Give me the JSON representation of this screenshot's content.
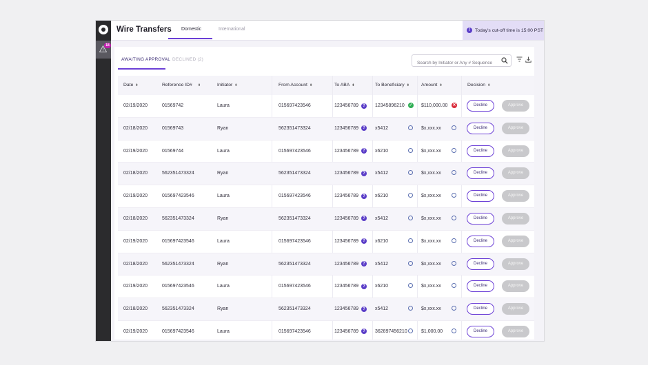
{
  "app": {
    "title": "Wire Transfers",
    "alert_badge": "18"
  },
  "top_tabs": [
    {
      "label": "Domestic",
      "active": true
    },
    {
      "label": "International",
      "active": false
    }
  ],
  "cutoff_notice": "Today's cut-off time is 15:00 PST",
  "sub_tabs": [
    {
      "label": "AWAITING APPROVAL",
      "active": true
    },
    {
      "label": "DECLINED (2)",
      "active": false
    }
  ],
  "search": {
    "placeholder": "Search by Initiator or Any # Sequence"
  },
  "columns": [
    "Date",
    "Reference ID#",
    "Initiator",
    "From Account",
    "To ABA",
    "To Beneficiary",
    "Amount",
    "Decision"
  ],
  "actions": {
    "decline": "Decline",
    "approve": "Approve"
  },
  "rows": [
    {
      "date": "02/19/2020",
      "ref": "01569742",
      "initiator": "Laura",
      "from": "015697423546",
      "aba": "123456789",
      "beneficiary": "12345896210",
      "ben_status": "verified",
      "amount": "$110,000.00",
      "amt_status": "error"
    },
    {
      "date": "02/18/2020",
      "ref": "01569743",
      "initiator": "Ryan",
      "from": "562351473324",
      "aba": "123456789",
      "beneficiary": "x5412",
      "ben_status": "pending",
      "amount": "$x,xxx.xx",
      "amt_status": "pending"
    },
    {
      "date": "02/19/2020",
      "ref": "01569744",
      "initiator": "Laura",
      "from": "015697423546",
      "aba": "123456789",
      "beneficiary": "x6210",
      "ben_status": "pending",
      "amount": "$x,xxx.xx",
      "amt_status": "pending"
    },
    {
      "date": "02/18/2020",
      "ref": "562351473324",
      "initiator": "Ryan",
      "from": "562351473324",
      "aba": "123456789",
      "beneficiary": "x5412",
      "ben_status": "pending",
      "amount": "$x,xxx.xx",
      "amt_status": "pending"
    },
    {
      "date": "02/19/2020",
      "ref": "015697423546",
      "initiator": "Laura",
      "from": "015697423546",
      "aba": "123456789",
      "beneficiary": "x6210",
      "ben_status": "pending",
      "amount": "$x,xxx.xx",
      "amt_status": "pending"
    },
    {
      "date": "02/18/2020",
      "ref": "562351473324",
      "initiator": "Ryan",
      "from": "562351473324",
      "aba": "123456789",
      "beneficiary": "x5412",
      "ben_status": "pending",
      "amount": "$x,xxx.xx",
      "amt_status": "pending"
    },
    {
      "date": "02/19/2020",
      "ref": "015697423546",
      "initiator": "Laura",
      "from": "015697423546",
      "aba": "123456789",
      "beneficiary": "x6210",
      "ben_status": "pending",
      "amount": "$x,xxx.xx",
      "amt_status": "pending"
    },
    {
      "date": "02/18/2020",
      "ref": "562351473324",
      "initiator": "Ryan",
      "from": "562351473324",
      "aba": "123456789",
      "beneficiary": "x5412",
      "ben_status": "pending",
      "amount": "$x,xxx.xx",
      "amt_status": "pending"
    },
    {
      "date": "02/19/2020",
      "ref": "015697423546",
      "initiator": "Laura",
      "from": "015697423546",
      "aba": "123456789",
      "beneficiary": "x6210",
      "ben_status": "pending",
      "amount": "$x,xxx.xx",
      "amt_status": "pending"
    },
    {
      "date": "02/18/2020",
      "ref": "562351473324",
      "initiator": "Ryan",
      "from": "562351473324",
      "aba": "123456789",
      "beneficiary": "x5412",
      "ben_status": "pending",
      "amount": "$x,xxx.xx",
      "amt_status": "pending"
    },
    {
      "date": "02/19/2020",
      "ref": "015697423546",
      "initiator": "Laura",
      "from": "015697423546",
      "aba": "123456789",
      "beneficiary": "362897456210",
      "ben_status": "pending",
      "amount": "$1,000.00",
      "amt_status": "pending"
    }
  ],
  "colors": {
    "accent": "#6b3fd6",
    "notice_bg": "#e3ddf6",
    "sidebar": "#2b2b2d",
    "badge": "#c51fb0",
    "verified": "#2fae54",
    "error": "#d92b3a"
  }
}
